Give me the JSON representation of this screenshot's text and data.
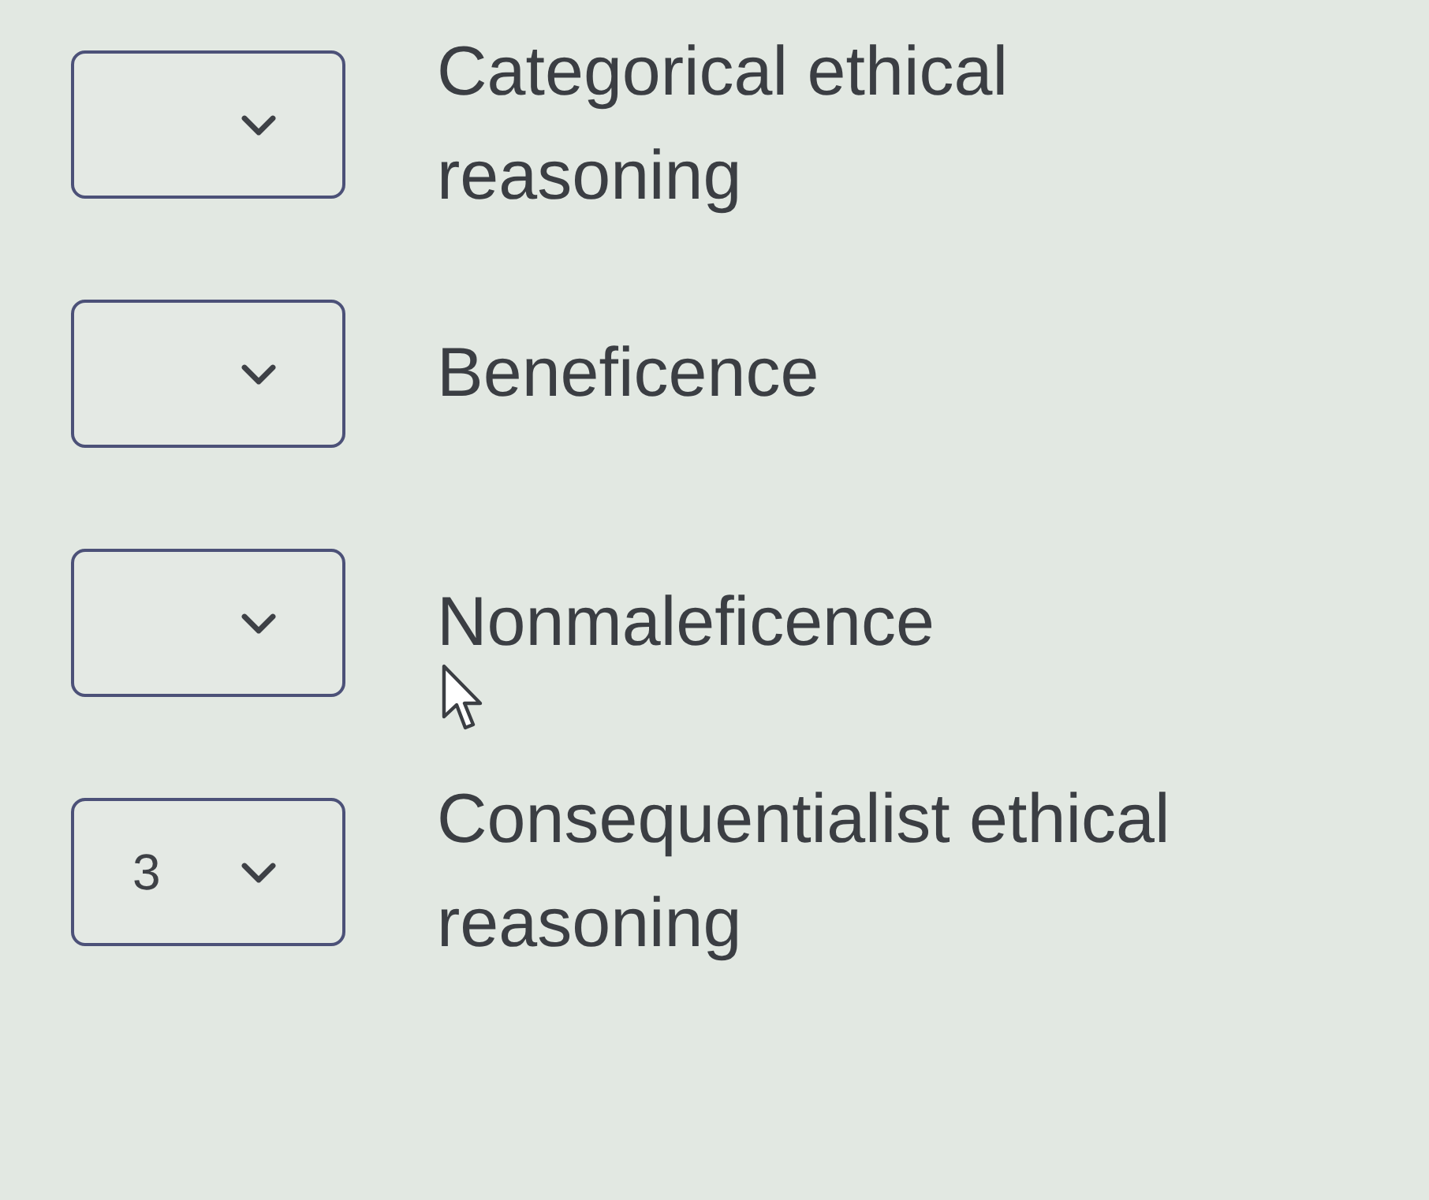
{
  "matching_items": [
    {
      "label": "Categorical ethical reasoning",
      "hovered": false
    },
    {
      "label": "Beneficence",
      "hovered": false
    },
    {
      "label": "Nonmaleficence",
      "hovered": true
    },
    {
      "label": "Consequentialist ethical reasoning",
      "selection": "3",
      "hovered": false
    }
  ]
}
